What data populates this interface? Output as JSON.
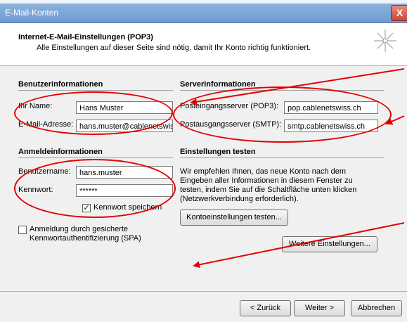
{
  "window": {
    "title": "E-Mail-Konten",
    "close_glyph": "X"
  },
  "header": {
    "title": "Internet-E-Mail-Einstellungen (POP3)",
    "subtitle": "Alle Einstellungen auf dieser Seite sind nötig, damit Ihr Konto richtig funktioniert."
  },
  "user_info": {
    "heading": "Benutzerinformationen",
    "name_label": "Ihr Name:",
    "name_value": "Hans Muster",
    "email_label": "E-Mail-Adresse:",
    "email_value": "hans.muster@cablenetswiss.ch"
  },
  "server_info": {
    "heading": "Serverinformationen",
    "incoming_label": "Posteingangsserver (POP3):",
    "incoming_value": "pop.cablenetswiss.ch",
    "outgoing_label": "Postausgangsserver (SMTP):",
    "outgoing_value": "smtp.cablenetswiss.ch"
  },
  "login_info": {
    "heading": "Anmeldeinformationen",
    "username_label": "Benutzername:",
    "username_value": "hans.muster",
    "password_label": "Kennwort:",
    "password_value": "******",
    "remember_label": "Kennwort speichern",
    "remember_checked": true,
    "spa_label_1": "Anmeldung durch gesicherte",
    "spa_label_2": "Kennwortauthentifizierung (SPA)",
    "spa_checked": false
  },
  "test_settings": {
    "heading": "Einstellungen testen",
    "description_1": "Wir empfehlen Ihnen, das neue Konto nach dem",
    "description_2": "Eingeben aller Informationen in diesem Fenster zu",
    "description_3": "testen, indem Sie auf die Schaltfläche unten klicken",
    "description_4": "(Netzwerkverbindung erforderlich).",
    "test_button": "Kontoeinstellungen testen...",
    "more_button": "Weitere Einstellungen..."
  },
  "footer": {
    "back": "< Zurück",
    "next": "Weiter >",
    "cancel": "Abbrechen"
  },
  "colors": {
    "annotation": "#e50000",
    "titlebar": "#7ba6d6"
  },
  "icons": [
    "wizard-sparkle-icon",
    "close-icon",
    "checkmark-icon"
  ]
}
